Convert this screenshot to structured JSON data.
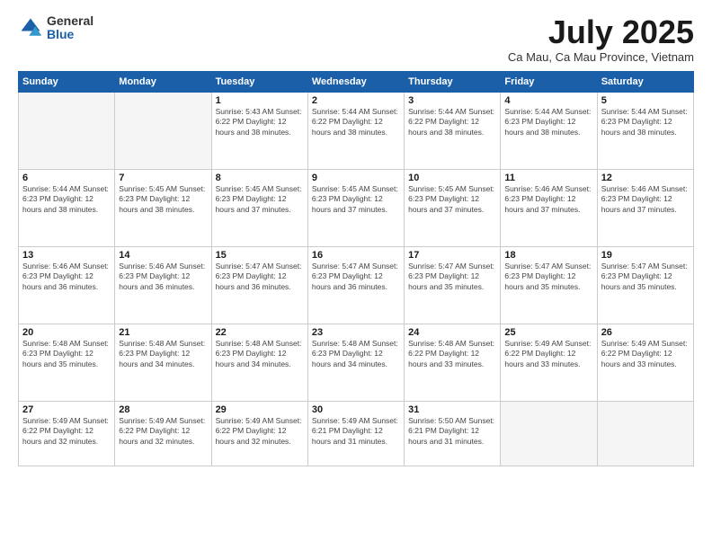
{
  "logo": {
    "general": "General",
    "blue": "Blue"
  },
  "title": "July 2025",
  "subtitle": "Ca Mau, Ca Mau Province, Vietnam",
  "headers": [
    "Sunday",
    "Monday",
    "Tuesday",
    "Wednesday",
    "Thursday",
    "Friday",
    "Saturday"
  ],
  "weeks": [
    [
      {
        "day": "",
        "info": ""
      },
      {
        "day": "",
        "info": ""
      },
      {
        "day": "1",
        "info": "Sunrise: 5:43 AM\nSunset: 6:22 PM\nDaylight: 12 hours and 38 minutes."
      },
      {
        "day": "2",
        "info": "Sunrise: 5:44 AM\nSunset: 6:22 PM\nDaylight: 12 hours and 38 minutes."
      },
      {
        "day": "3",
        "info": "Sunrise: 5:44 AM\nSunset: 6:22 PM\nDaylight: 12 hours and 38 minutes."
      },
      {
        "day": "4",
        "info": "Sunrise: 5:44 AM\nSunset: 6:23 PM\nDaylight: 12 hours and 38 minutes."
      },
      {
        "day": "5",
        "info": "Sunrise: 5:44 AM\nSunset: 6:23 PM\nDaylight: 12 hours and 38 minutes."
      }
    ],
    [
      {
        "day": "6",
        "info": "Sunrise: 5:44 AM\nSunset: 6:23 PM\nDaylight: 12 hours and 38 minutes."
      },
      {
        "day": "7",
        "info": "Sunrise: 5:45 AM\nSunset: 6:23 PM\nDaylight: 12 hours and 38 minutes."
      },
      {
        "day": "8",
        "info": "Sunrise: 5:45 AM\nSunset: 6:23 PM\nDaylight: 12 hours and 37 minutes."
      },
      {
        "day": "9",
        "info": "Sunrise: 5:45 AM\nSunset: 6:23 PM\nDaylight: 12 hours and 37 minutes."
      },
      {
        "day": "10",
        "info": "Sunrise: 5:45 AM\nSunset: 6:23 PM\nDaylight: 12 hours and 37 minutes."
      },
      {
        "day": "11",
        "info": "Sunrise: 5:46 AM\nSunset: 6:23 PM\nDaylight: 12 hours and 37 minutes."
      },
      {
        "day": "12",
        "info": "Sunrise: 5:46 AM\nSunset: 6:23 PM\nDaylight: 12 hours and 37 minutes."
      }
    ],
    [
      {
        "day": "13",
        "info": "Sunrise: 5:46 AM\nSunset: 6:23 PM\nDaylight: 12 hours and 36 minutes."
      },
      {
        "day": "14",
        "info": "Sunrise: 5:46 AM\nSunset: 6:23 PM\nDaylight: 12 hours and 36 minutes."
      },
      {
        "day": "15",
        "info": "Sunrise: 5:47 AM\nSunset: 6:23 PM\nDaylight: 12 hours and 36 minutes."
      },
      {
        "day": "16",
        "info": "Sunrise: 5:47 AM\nSunset: 6:23 PM\nDaylight: 12 hours and 36 minutes."
      },
      {
        "day": "17",
        "info": "Sunrise: 5:47 AM\nSunset: 6:23 PM\nDaylight: 12 hours and 35 minutes."
      },
      {
        "day": "18",
        "info": "Sunrise: 5:47 AM\nSunset: 6:23 PM\nDaylight: 12 hours and 35 minutes."
      },
      {
        "day": "19",
        "info": "Sunrise: 5:47 AM\nSunset: 6:23 PM\nDaylight: 12 hours and 35 minutes."
      }
    ],
    [
      {
        "day": "20",
        "info": "Sunrise: 5:48 AM\nSunset: 6:23 PM\nDaylight: 12 hours and 35 minutes."
      },
      {
        "day": "21",
        "info": "Sunrise: 5:48 AM\nSunset: 6:23 PM\nDaylight: 12 hours and 34 minutes."
      },
      {
        "day": "22",
        "info": "Sunrise: 5:48 AM\nSunset: 6:23 PM\nDaylight: 12 hours and 34 minutes."
      },
      {
        "day": "23",
        "info": "Sunrise: 5:48 AM\nSunset: 6:23 PM\nDaylight: 12 hours and 34 minutes."
      },
      {
        "day": "24",
        "info": "Sunrise: 5:48 AM\nSunset: 6:22 PM\nDaylight: 12 hours and 33 minutes."
      },
      {
        "day": "25",
        "info": "Sunrise: 5:49 AM\nSunset: 6:22 PM\nDaylight: 12 hours and 33 minutes."
      },
      {
        "day": "26",
        "info": "Sunrise: 5:49 AM\nSunset: 6:22 PM\nDaylight: 12 hours and 33 minutes."
      }
    ],
    [
      {
        "day": "27",
        "info": "Sunrise: 5:49 AM\nSunset: 6:22 PM\nDaylight: 12 hours and 32 minutes."
      },
      {
        "day": "28",
        "info": "Sunrise: 5:49 AM\nSunset: 6:22 PM\nDaylight: 12 hours and 32 minutes."
      },
      {
        "day": "29",
        "info": "Sunrise: 5:49 AM\nSunset: 6:22 PM\nDaylight: 12 hours and 32 minutes."
      },
      {
        "day": "30",
        "info": "Sunrise: 5:49 AM\nSunset: 6:21 PM\nDaylight: 12 hours and 31 minutes."
      },
      {
        "day": "31",
        "info": "Sunrise: 5:50 AM\nSunset: 6:21 PM\nDaylight: 12 hours and 31 minutes."
      },
      {
        "day": "",
        "info": ""
      },
      {
        "day": "",
        "info": ""
      }
    ]
  ]
}
